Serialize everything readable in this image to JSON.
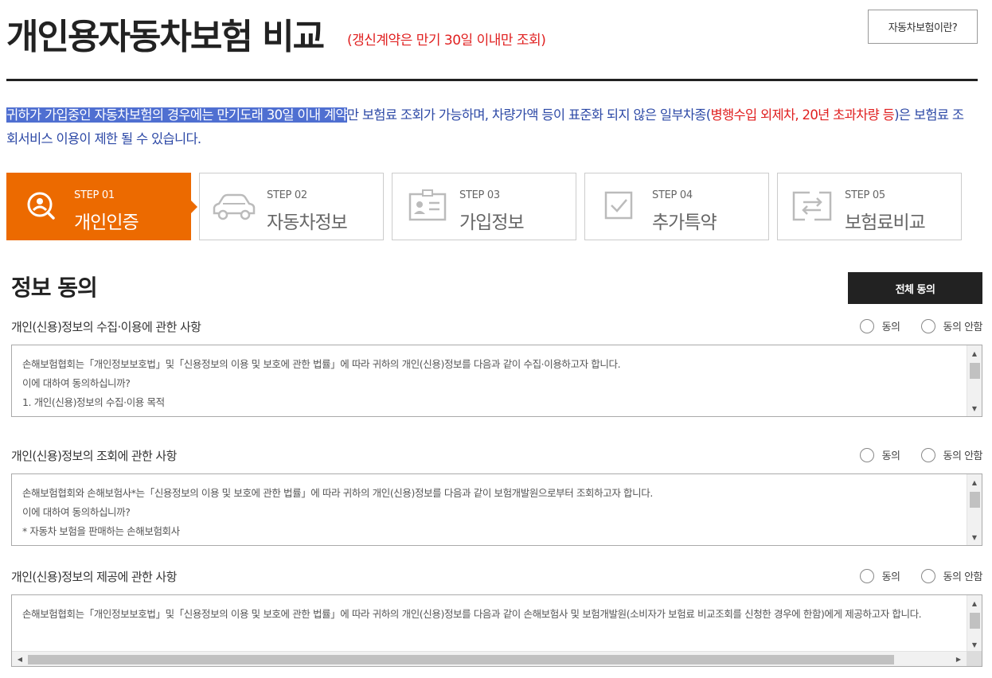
{
  "header": {
    "title": "개인용자동차보험 비교",
    "subnote": "(갱신계약은 만기 30일 이내만 조회)",
    "help_button": "자동차보험이란?"
  },
  "notice": {
    "selected_part": "귀하가 가입중인 자동차보험의 경우에는 만기도래 30일 이내 계약",
    "part2": "만 보험료 조회가 가능하며, 차량가액 등이 표준화 되지 않은 일부차종(",
    "red_part": "병행수입 외제차, 20년 초과차량 등",
    "part3": ")은 보험료 조회서비스 이용이 제한 될 수 있습니다."
  },
  "steps": [
    {
      "label": "STEP 01",
      "name": "개인인증",
      "icon": "search-person-icon",
      "active": true
    },
    {
      "label": "STEP 02",
      "name": "자동차정보",
      "icon": "car-icon",
      "active": false
    },
    {
      "label": "STEP 03",
      "name": "가입정보",
      "icon": "id-card-icon",
      "active": false
    },
    {
      "label": "STEP 04",
      "name": "추가특약",
      "icon": "checkbox-icon",
      "active": false
    },
    {
      "label": "STEP 05",
      "name": "보험료비교",
      "icon": "compare-arrows-icon",
      "active": false
    }
  ],
  "consent": {
    "title": "정보 동의",
    "agree_all": "전체 동의",
    "agree_label": "동의",
    "disagree_label": "동의 안함",
    "sections": [
      {
        "title": "개인(신용)정보의 수집·이용에 관한 사항",
        "lines": [
          "손해보험협회는「개인정보보호법」및「신용정보의 이용 및 보호에 관한 법률」에 따라 귀하의 개인(신용)정보를 다음과 같이 수집·이용하고자 합니다.",
          "이에 대하여 동의하십니까?",
          "1. 개인(신용)정보의 수집·이용 목적"
        ]
      },
      {
        "title": "개인(신용)정보의 조회에 관한 사항",
        "lines": [
          "손해보험협회와 손해보험사*는「신용정보의 이용 및 보호에 관한 법률」에 따라 귀하의 개인(신용)정보를 다음과 같이 보험개발원으로부터 조회하고자 합니다.",
          "이에 대하여 동의하십니까?",
          "* 자동차 보험을 판매하는 손해보험회사"
        ]
      },
      {
        "title": "개인(신용)정보의 제공에 관한 사항",
        "lines": [
          "손해보험협회는「개인정보보호법」및「신용정보의 이용 및 보호에 관한 법률」에 따라 귀하의 개인(신용)정보를 다음과 같이 손해보험사 및 보험개발원(소비자가 보험료 비교조회를 신청한 경우에 한함)에게 제공하고자 합니다."
        ]
      }
    ]
  },
  "colors": {
    "accent": "#ec6a00",
    "notice_blue": "#2d49a6",
    "warning_red": "#e02020",
    "dark_button": "#222222"
  }
}
